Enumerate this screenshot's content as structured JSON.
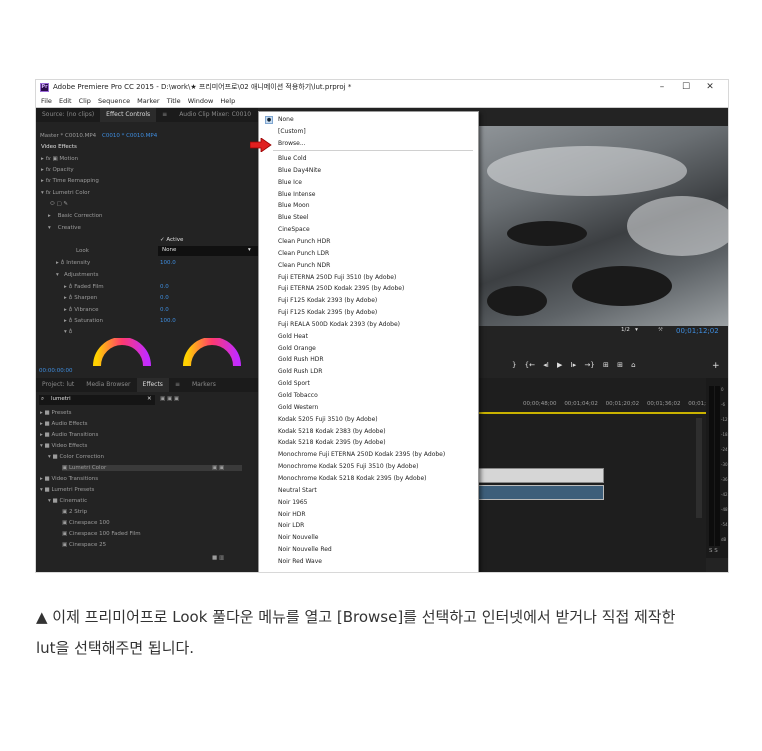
{
  "window": {
    "app_icon": "Pr",
    "title": "Adobe Premiere Pro CC 2015 - D:\\work\\★ 프리미어프로\\02 애니메이션 적용하기\\lut.prproj *",
    "controls": [
      "–",
      "☐",
      "✕"
    ]
  },
  "menubar": [
    "File",
    "Edit",
    "Clip",
    "Sequence",
    "Marker",
    "Title",
    "Window",
    "Help"
  ],
  "effect_controls": {
    "tabs": [
      "Source: (no clips)",
      "Effect Controls",
      "≡",
      "Audio Clip Mixer: C0010"
    ],
    "master": "Master * C0010.MP4",
    "clip": "C0010 * C0010.MP4",
    "section": "Video Effects",
    "fx": [
      "Motion",
      "Opacity",
      "Time Remapping",
      "Lumetri Color"
    ],
    "basic_correction": "Basic Correction",
    "creative": "Creative",
    "active_label": "✓ Active",
    "look_label": "Look",
    "look_value": "None",
    "intensity": {
      "label": "Intensity",
      "value": "100.0"
    },
    "adjustments": "Adjustments",
    "params": [
      {
        "label": "Faded Film",
        "value": "0.0"
      },
      {
        "label": "Sharpen",
        "value": "0.0"
      },
      {
        "label": "Vibrance",
        "value": "0.0"
      },
      {
        "label": "Saturation",
        "value": "100.0"
      }
    ],
    "timecode": "00:00:00:00"
  },
  "project": {
    "tabs": [
      "Project: lut",
      "Media Browser",
      "Effects",
      "≡",
      "Markers"
    ],
    "search_value": "lumetri",
    "tree": [
      "Presets",
      "Audio Effects",
      "Audio Transitions",
      "Video Effects",
      "Color Correction",
      "Lumetri Color",
      "Video Transitions",
      "Lumetri Presets",
      "Cinematic",
      "2 Strip",
      "Cinespace 100",
      "Cinespace 100 Faded Film",
      "Cinespace 25"
    ]
  },
  "look_menu": {
    "items": [
      "None",
      "[Custom]",
      "Browse...",
      "Blue Cold",
      "Blue Day4Nite",
      "Blue Ice",
      "Blue Intense",
      "Blue Moon",
      "Blue Steel",
      "CineSpace",
      "Clean Punch HDR",
      "Clean Punch LDR",
      "Clean Punch NDR",
      "Fuji ETERNA 250D Fuji 3510 (by Adobe)",
      "Fuji ETERNA 250D Kodak 2395 (by Adobe)",
      "Fuji F125 Kodak 2393 (by Adobe)",
      "Fuji F125 Kodak 2395 (by Adobe)",
      "Fuji REALA 500D Kodak 2393 (by Adobe)",
      "Gold Heat",
      "Gold Orange",
      "Gold Rush HDR",
      "Gold Rush LDR",
      "Gold Sport",
      "Gold Tobacco",
      "Gold Western",
      "Kodak 5205 Fuji 3510 (by Adobe)",
      "Kodak 5218 Kodak 2383 (by Adobe)",
      "Kodak 5218 Kodak 2395 (by Adobe)",
      "Monochrome Fuji ETERNA 250D Kodak 2395 (by Adobe)",
      "Monochrome Kodak 5205 Fuji 3510 (by Adobe)",
      "Monochrome Kodak 5218 Kodak 2395 (by Adobe)",
      "Neutral Start",
      "Noir 1965",
      "Noir HDR",
      "Noir LDR",
      "Noir Nouvelle",
      "Noir Nouvelle Red",
      "Noir Red Wave"
    ]
  },
  "program": {
    "zoom": "1/2",
    "timecode": "00;01;12;02",
    "ruler": [
      "00;00;48;00",
      "00;01;04;02",
      "00;01;20;02",
      "00;01;36;02",
      "00;01;52"
    ],
    "meter_labels": [
      "0",
      "-6",
      "-12",
      "-18",
      "-24",
      "-30",
      "-36",
      "-42",
      "-48",
      "-54",
      "dB"
    ],
    "solo": "S  S"
  },
  "caption": {
    "line1": "▲ 이제 프리미어프로 Look 풀다운 메뉴를 열고 [Browse]를 선택하고 인터넷에서 받거나 직접 제작한",
    "line2": "lut을 선택해주면 됩니다."
  },
  "colors": {
    "accent_blue": "#3f8ee0",
    "arrow_red": "#e02020"
  }
}
